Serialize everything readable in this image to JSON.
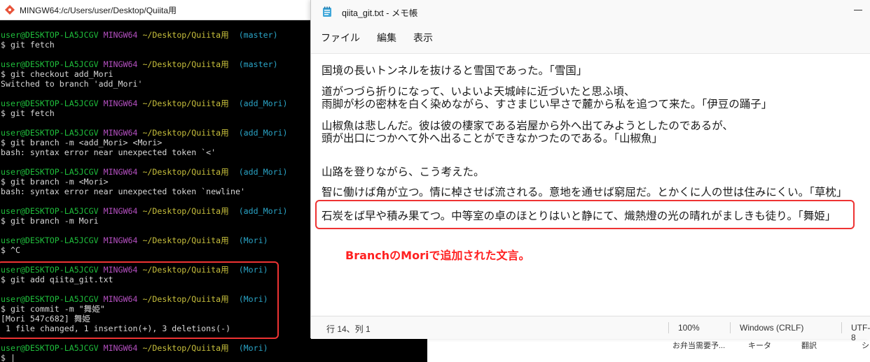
{
  "terminal": {
    "title": "MINGW64:/c/Users/user/Desktop/Quiita用",
    "lines": [
      {
        "user": "user@DESKTOP-LA5JCGV",
        "mingw": "MINGW64",
        "path": "~/Desktop/Quiita用",
        "branch": "(master)"
      },
      "$ git fetch",
      "",
      {
        "user": "user@DESKTOP-LA5JCGV",
        "mingw": "MINGW64",
        "path": "~/Desktop/Quiita用",
        "branch": "(master)"
      },
      "$ git checkout add_Mori",
      "Switched to branch 'add_Mori'",
      "",
      {
        "user": "user@DESKTOP-LA5JCGV",
        "mingw": "MINGW64",
        "path": "~/Desktop/Quiita用",
        "branch": "(add_Mori)"
      },
      "$ git fetch",
      "",
      {
        "user": "user@DESKTOP-LA5JCGV",
        "mingw": "MINGW64",
        "path": "~/Desktop/Quiita用",
        "branch": "(add_Mori)"
      },
      "$ git branch -m <add_Mori> <Mori>",
      "bash: syntax error near unexpected token `<'",
      "",
      {
        "user": "user@DESKTOP-LA5JCGV",
        "mingw": "MINGW64",
        "path": "~/Desktop/Quiita用",
        "branch": "(add_Mori)"
      },
      "$ git branch -m <Mori>",
      "bash: syntax error near unexpected token `newline'",
      "",
      {
        "user": "user@DESKTOP-LA5JCGV",
        "mingw": "MINGW64",
        "path": "~/Desktop/Quiita用",
        "branch": "(add_Mori)"
      },
      "$ git branch -m Mori",
      "",
      {
        "user": "user@DESKTOP-LA5JCGV",
        "mingw": "MINGW64",
        "path": "~/Desktop/Quiita用",
        "branch": "(Mori)"
      },
      "$ ^C",
      "",
      {
        "user": "user@DESKTOP-LA5JCGV",
        "mingw": "MINGW64",
        "path": "~/Desktop/Quiita用",
        "branch": "(Mori)"
      },
      "$ git add qiita_git.txt",
      "",
      {
        "user": "user@DESKTOP-LA5JCGV",
        "mingw": "MINGW64",
        "path": "~/Desktop/Quiita用",
        "branch": "(Mori)"
      },
      "$ git commit -m \"舞姫\"",
      "[Mori 547c682] 舞姫",
      " 1 file changed, 1 insertion(+), 3 deletions(-)",
      "",
      {
        "user": "user@DESKTOP-LA5JCGV",
        "mingw": "MINGW64",
        "path": "~/Desktop/Quiita用",
        "branch": "(Mori)"
      },
      "$ |"
    ]
  },
  "notepad": {
    "title": "qiita_git.txt - メモ帳",
    "menu": [
      "ファイル",
      "編集",
      "表示"
    ],
    "text_lines": [
      "国境の長いトンネルを抜けると雪国であった。「雪国」",
      "道がつづら折りになって、いよいよ天城峠に近づいたと思ふ頃、",
      "雨脚が杉の密林を白く染めながら、すさまじい早さで麓から私を追つて来た。「伊豆の踊子」",
      "山椒魚は悲しんだ。彼は彼の棲家である岩屋から外へ出てみようとしたのであるが、",
      "頭が出口につかへて外へ出ることができなかつたのである。「山椒魚」",
      "山路を登りながら、こう考えた。",
      "智に働けば角が立つ。情に棹させば流される。意地を通せば窮屈だ。とかくに人の世は住みにくい。「草枕」",
      "石炭をば早や積み果てつ。中等室の卓のほとりはいと静にて、熾熱燈の光の晴れがましきも徒り。「舞姫」"
    ],
    "status": {
      "position": "行 14、列 1",
      "zoom": "100%",
      "line_ending": "Windows (CRLF)",
      "encoding": "UTF-8"
    }
  },
  "annotation": "BranchのMoriで追加された文言。",
  "background": {
    "taskbar_items": [
      "お弁当需要予...",
      "キータ",
      "翻訳",
      "シ"
    ]
  },
  "colors": {
    "terminal_user": "#1fbf3c",
    "terminal_mingw": "#b34fbf",
    "terminal_path": "#c7bf3c",
    "terminal_branch": "#2aa4c6",
    "highlight": "#e33333"
  }
}
